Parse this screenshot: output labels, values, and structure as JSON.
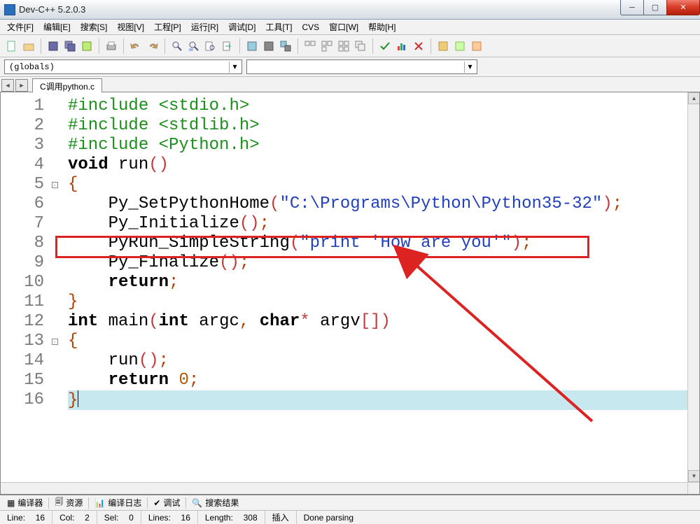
{
  "title": "Dev-C++ 5.2.0.3",
  "menu": [
    "文件[F]",
    "编辑[E]",
    "搜索[S]",
    "视图[V]",
    "工程[P]",
    "运行[R]",
    "调试[D]",
    "工具[T]",
    "CVS",
    "窗口[W]",
    "帮助[H]"
  ],
  "combo_left": "(globals)",
  "combo_right": "",
  "tab_name": "C调用python.c",
  "code_lines": [
    {
      "n": 1,
      "seg": [
        {
          "c": "c-pre",
          "t": "#include "
        },
        {
          "c": "c-pre",
          "t": "<stdio.h>"
        }
      ]
    },
    {
      "n": 2,
      "seg": [
        {
          "c": "c-pre",
          "t": "#include "
        },
        {
          "c": "c-pre",
          "t": "<stdlib.h>"
        }
      ]
    },
    {
      "n": 3,
      "seg": [
        {
          "c": "c-pre",
          "t": "#include "
        },
        {
          "c": "c-pre",
          "t": "<Python.h>"
        }
      ]
    },
    {
      "n": 4,
      "seg": [
        {
          "c": "c-kw",
          "t": "void"
        },
        {
          "c": "",
          "t": " run"
        },
        {
          "c": "c-paren",
          "t": "()"
        }
      ]
    },
    {
      "n": 5,
      "fold": true,
      "seg": [
        {
          "c": "c-brace",
          "t": "{"
        }
      ]
    },
    {
      "n": 6,
      "indent": 1,
      "seg": [
        {
          "c": "",
          "t": "Py_SetPythonHome"
        },
        {
          "c": "c-paren",
          "t": "("
        },
        {
          "c": "c-str",
          "t": "\"C:\\Programs\\Python\\Python35-32\""
        },
        {
          "c": "c-paren",
          "t": ")"
        },
        {
          "c": "c-punc",
          "t": ";"
        }
      ]
    },
    {
      "n": 7,
      "indent": 1,
      "seg": [
        {
          "c": "",
          "t": "Py_Initialize"
        },
        {
          "c": "c-paren",
          "t": "()"
        },
        {
          "c": "c-punc",
          "t": ";"
        }
      ]
    },
    {
      "n": 8,
      "indent": 1,
      "seg": [
        {
          "c": "",
          "t": "PyRun_SimpleString"
        },
        {
          "c": "c-paren",
          "t": "("
        },
        {
          "c": "c-str",
          "t": "\"print 'How are you'\""
        },
        {
          "c": "c-paren",
          "t": ")"
        },
        {
          "c": "c-punc",
          "t": ";"
        }
      ]
    },
    {
      "n": 9,
      "indent": 1,
      "seg": [
        {
          "c": "",
          "t": "Py_Finalize"
        },
        {
          "c": "c-paren",
          "t": "()"
        },
        {
          "c": "c-punc",
          "t": ";"
        }
      ]
    },
    {
      "n": 10,
      "indent": 1,
      "seg": [
        {
          "c": "c-kw",
          "t": "return"
        },
        {
          "c": "c-punc",
          "t": ";"
        }
      ]
    },
    {
      "n": 11,
      "seg": [
        {
          "c": "c-brace",
          "t": "}"
        }
      ]
    },
    {
      "n": 12,
      "seg": [
        {
          "c": "c-kw",
          "t": "int"
        },
        {
          "c": "",
          "t": " main"
        },
        {
          "c": "c-paren",
          "t": "("
        },
        {
          "c": "c-kw",
          "t": "int"
        },
        {
          "c": "",
          "t": " argc"
        },
        {
          "c": "c-punc",
          "t": ","
        },
        {
          "c": "",
          "t": " "
        },
        {
          "c": "c-kw",
          "t": "char"
        },
        {
          "c": "c-paren",
          "t": "*"
        },
        {
          "c": "",
          "t": " argv"
        },
        {
          "c": "c-paren",
          "t": "[])"
        }
      ]
    },
    {
      "n": 13,
      "fold": true,
      "seg": [
        {
          "c": "c-brace",
          "t": "{"
        }
      ]
    },
    {
      "n": 14,
      "indent": 1,
      "seg": [
        {
          "c": "",
          "t": "run"
        },
        {
          "c": "c-paren",
          "t": "()"
        },
        {
          "c": "c-punc",
          "t": ";"
        }
      ]
    },
    {
      "n": 15,
      "indent": 1,
      "seg": [
        {
          "c": "c-kw",
          "t": "return"
        },
        {
          "c": "",
          "t": " "
        },
        {
          "c": "c-num",
          "t": "0"
        },
        {
          "c": "c-punc",
          "t": ";"
        }
      ]
    },
    {
      "n": 16,
      "seg": [
        {
          "c": "c-brace",
          "t": "}"
        }
      ],
      "current": true,
      "cursor": true
    }
  ],
  "bottom_tabs": [
    {
      "icon": "grid",
      "label": "编译器"
    },
    {
      "icon": "res",
      "label": "资源"
    },
    {
      "icon": "bar",
      "label": "编译日志"
    },
    {
      "icon": "check",
      "label": "调试"
    },
    {
      "icon": "search",
      "label": "搜索结果"
    }
  ],
  "status": {
    "line_lbl": "Line:",
    "line": "16",
    "col_lbl": "Col:",
    "col": "2",
    "sel_lbl": "Sel:",
    "sel": "0",
    "lines_lbl": "Lines:",
    "lines": "16",
    "length_lbl": "Length:",
    "length": "308",
    "mode": "插入",
    "parse": "Done parsing"
  }
}
